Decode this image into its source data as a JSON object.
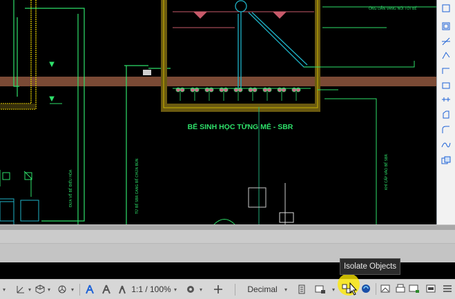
{
  "drawing": {
    "title_label": "BỂ SINH HỌC TỪNG MẺ - SBR",
    "note_top_right": "ỐNG DẪN VANG NỐI TỚI BỂ",
    "vertical_labels": [
      "ĐƯA VỀ BỂ ĐIỀU HÒA",
      "TỪ BỂ SBR CANG BỂ CHỨA BÙN",
      "KHÍ CẤP VÀO BỂ SBR"
    ]
  },
  "right_toolbar": {
    "tools": [
      "view-cube-icon",
      "selection-icon",
      "line-icon",
      "polyline-icon",
      "arc-icon",
      "rectangle-icon",
      "move-icon",
      "trim-icon",
      "polygon-icon",
      "fillet-icon",
      "spline-icon",
      "copy-icon"
    ]
  },
  "status_bar": {
    "annotation_scale": "1:1 / 100%",
    "units": "Decimal"
  },
  "tooltip": {
    "text": "Isolate Objects"
  },
  "colors": {
    "canvas_bg": "#000000",
    "pipe_green": "#2ee06a",
    "water_cyan": "#1fb3c8",
    "wall_yellow": "#c8b400",
    "soil_brown": "#7a4a35",
    "highlight_yellow": "#ffe800",
    "accent_blue": "#1d62d6"
  }
}
